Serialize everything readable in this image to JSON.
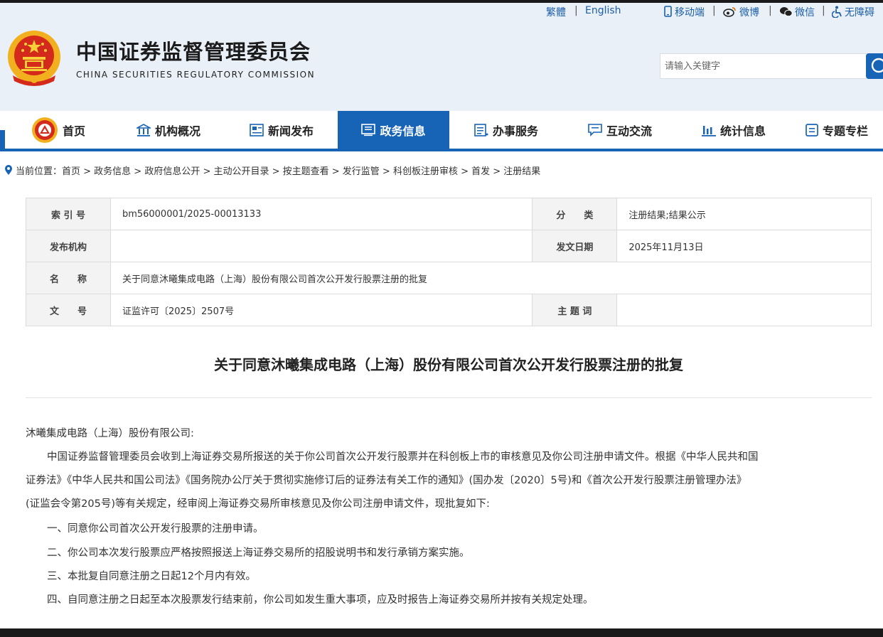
{
  "top_links": {
    "traditional": "繁體",
    "english": "English",
    "mobile": "移动端",
    "weibo": "微博",
    "wechat": "微信",
    "accessibility": "无障碍"
  },
  "site": {
    "name_cn": "中国证券监督管理委员会",
    "name_en": "CHINA SECURITIES REGULATORY COMMISSION"
  },
  "search": {
    "placeholder": "请输入关键字"
  },
  "nav": {
    "items": [
      {
        "label": "首页",
        "icon": "emblem-icon"
      },
      {
        "label": "机构概况",
        "icon": "building-icon"
      },
      {
        "label": "新闻发布",
        "icon": "news-icon"
      },
      {
        "label": "政务信息",
        "icon": "gov-info-icon",
        "active": true
      },
      {
        "label": "办事服务",
        "icon": "service-icon"
      },
      {
        "label": "互动交流",
        "icon": "chat-icon"
      },
      {
        "label": "统计信息",
        "icon": "chart-icon"
      },
      {
        "label": "专题专栏",
        "icon": "topic-icon"
      }
    ]
  },
  "breadcrumb": {
    "text": "当前位置：首页 > 政务信息 > 政府信息公开 > 主动公开目录 > 按主题查看 > 发行监管 > 科创板注册审核 > 首发 > 注册结果"
  },
  "meta": {
    "index_label": "索 引 号",
    "index_value": "bm56000001/2025-00013133",
    "category_label": "分　　类",
    "category_value": "注册结果;结果公示",
    "publisher_label": "发布机构",
    "publisher_value": "",
    "date_label": "发文日期",
    "date_value": "2025年11月13日",
    "name_label": "名　　称",
    "name_value": "关于同意沐曦集成电路（上海）股份有限公司首次公开发行股票注册的批复",
    "docno_label": "文　　号",
    "docno_value": "证监许可〔2025〕2507号",
    "keywords_label": "主 题 词",
    "keywords_value": ""
  },
  "doc": {
    "title": "关于同意沐曦集成电路（上海）股份有限公司首次公开发行股票注册的批复",
    "addressee": "沐曦集成电路（上海）股份有限公司:",
    "p1_line1": "中国证券监督管理委员会收到上海证券交易所报送的关于你公司首次公开发行股票并在科创板上市的审核意见及你公司注册申请文件。根据《中华人民共和国",
    "p1_line2": "证券法》《中华人民共和国公司法》《国务院办公厅关于贯彻实施修订后的证券法有关工作的通知》(国办发〔2020〕5号)和《首次公开发行股票注册管理办法》",
    "p1_line3": "(证监会令第205号)等有关规定，经审阅上海证券交易所审核意见及你公司注册申请文件，现批复如下:",
    "item1": "一、同意你公司首次公开发行股票的注册申请。",
    "item2": "二、你公司本次发行股票应严格按照报送上海证券交易所的招股说明书和发行承销方案实施。",
    "item3": "三、本批复自同意注册之日起12个月内有效。",
    "item4": "四、自同意注册之日起至本次股票发行结束前，你公司如发生重大事项，应及时报告上海证券交易所并按有关规定处理。"
  },
  "colors": {
    "primary": "#1763b6",
    "header_bg": "#e9f0f7",
    "link": "#1d5ea8"
  }
}
